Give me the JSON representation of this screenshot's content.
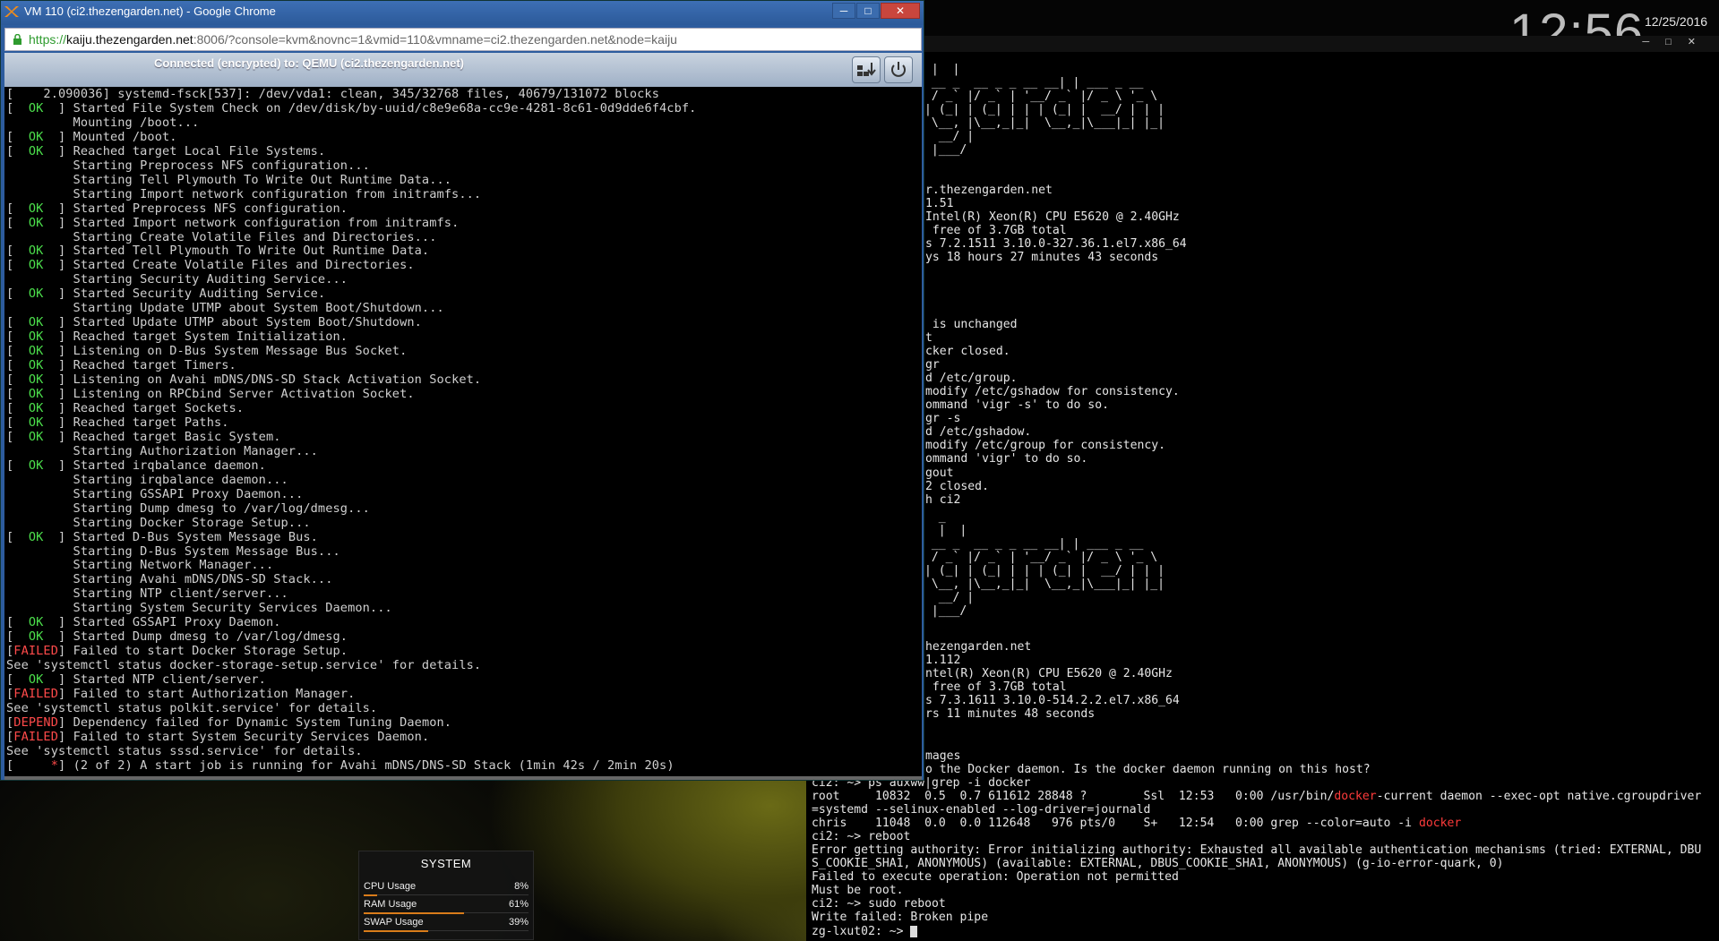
{
  "desktop": {
    "clock": "12:56",
    "date": "12/25/2016"
  },
  "browser": {
    "title": "VM 110 (ci2.thezengarden.net) - Google Chrome",
    "url_scheme": "https://",
    "url_host": "kaiju.thezengarden.net",
    "url_rest": ":8006/?console=kvm&novnc=1&vmid=110&vmname=ci2.thezengarden.net&node=kaiju",
    "minimize_label": "─",
    "maximize_label": "□",
    "close_label": "✕"
  },
  "novnc": {
    "status": "Connected (encrypted) to: QEMU (ci2.thezengarden.net)",
    "send_keys_icon": "keyboard-send-icon",
    "power_icon": "power-icon"
  },
  "console_lines": [
    {
      "text": "[    2.090036] systemd-fsck[537]: /dev/vda1: clean, 345/32768 files, 40679/131072 blocks"
    },
    {
      "status": "OK",
      "text": "Started File System Check on /dev/disk/by-uuid/c8e9e68a-cc9e-4281-8c61-0d9dde6f4cbf."
    },
    {
      "text": "         Mounting /boot..."
    },
    {
      "status": "OK",
      "text": "Mounted /boot."
    },
    {
      "status": "OK",
      "text": "Reached target Local File Systems."
    },
    {
      "text": "         Starting Preprocess NFS configuration..."
    },
    {
      "text": "         Starting Tell Plymouth To Write Out Runtime Data..."
    },
    {
      "text": "         Starting Import network configuration from initramfs..."
    },
    {
      "status": "OK",
      "text": "Started Preprocess NFS configuration."
    },
    {
      "status": "OK",
      "text": "Started Import network configuration from initramfs."
    },
    {
      "text": "         Starting Create Volatile Files and Directories..."
    },
    {
      "status": "OK",
      "text": "Started Tell Plymouth To Write Out Runtime Data."
    },
    {
      "status": "OK",
      "text": "Started Create Volatile Files and Directories."
    },
    {
      "text": "         Starting Security Auditing Service..."
    },
    {
      "status": "OK",
      "text": "Started Security Auditing Service."
    },
    {
      "text": "         Starting Update UTMP about System Boot/Shutdown..."
    },
    {
      "status": "OK",
      "text": "Started Update UTMP about System Boot/Shutdown."
    },
    {
      "status": "OK",
      "text": "Reached target System Initialization."
    },
    {
      "status": "OK",
      "text": "Listening on D-Bus System Message Bus Socket."
    },
    {
      "status": "OK",
      "text": "Reached target Timers."
    },
    {
      "status": "OK",
      "text": "Listening on Avahi mDNS/DNS-SD Stack Activation Socket."
    },
    {
      "status": "OK",
      "text": "Listening on RPCbind Server Activation Socket."
    },
    {
      "status": "OK",
      "text": "Reached target Sockets."
    },
    {
      "status": "OK",
      "text": "Reached target Paths."
    },
    {
      "status": "OK",
      "text": "Reached target Basic System."
    },
    {
      "text": "         Starting Authorization Manager..."
    },
    {
      "status": "OK",
      "text": "Started irqbalance daemon."
    },
    {
      "text": "         Starting irqbalance daemon..."
    },
    {
      "text": "         Starting GSSAPI Proxy Daemon..."
    },
    {
      "text": "         Starting Dump dmesg to /var/log/dmesg..."
    },
    {
      "text": "         Starting Docker Storage Setup..."
    },
    {
      "status": "OK",
      "text": "Started D-Bus System Message Bus."
    },
    {
      "text": "         Starting D-Bus System Message Bus..."
    },
    {
      "text": "         Starting Network Manager..."
    },
    {
      "text": "         Starting Avahi mDNS/DNS-SD Stack..."
    },
    {
      "text": "         Starting NTP client/server..."
    },
    {
      "text": "         Starting System Security Services Daemon..."
    },
    {
      "status": "OK",
      "text": "Started GSSAPI Proxy Daemon."
    },
    {
      "status": "OK",
      "text": "Started Dump dmesg to /var/log/dmesg."
    },
    {
      "status": "FAILED",
      "text": "Failed to start Docker Storage Setup."
    },
    {
      "text": "See 'systemctl status docker-storage-setup.service' for details."
    },
    {
      "status": "OK",
      "text": "Started NTP client/server."
    },
    {
      "status": "FAILED",
      "text": "Failed to start Authorization Manager."
    },
    {
      "text": "See 'systemctl status polkit.service' for details."
    },
    {
      "status": "DEPEND",
      "text": "Dependency failed for Dynamic System Tuning Daemon."
    },
    {
      "status": "FAILED",
      "text": "Failed to start System Security Services Daemon."
    },
    {
      "text": "See 'systemctl status sssd.service' for details."
    },
    {
      "status": "SPIN",
      "text": "(2 of 2) A start job is running for Avahi mDNS/DNS-SD Stack (1min 42s / 2min 20s)"
    }
  ],
  "terminal": {
    "minimize_label": "─",
    "maximize_label": "□",
    "close_label": "✕",
    "banner1": " |  |\n __ _  __ _ _ __ __| | ___ _ __\n / _` |/ _` | '__/ _` |/ _ \\ '_ \\\n| (_| | (_| | | | (_| |  __/ | | |\n \\__, |\\__,_|_|  \\__,_|\\___|_| |_|\n  __/ |\n |___/",
    "info1": "r.thezengarden.net\n1.51\nIntel(R) Xeon(R) CPU E5620 @ 2.40GHz\n free of 3.7GB total\ns 7.2.1511 3.10.0-327.36.1.el7.x86_64\nys 18 hours 27 minutes 43 seconds",
    "log": " is unchanged\nt\ncker closed.\ngr\nd /etc/group.\nmodify /etc/gshadow for consistency.\nommand 'vigr -s' to do so.\ngr -s\nd /etc/gshadow.\nmodify /etc/group for consistency.\nommand 'vigr' to do so.\ngout\n2 closed.\nh ci2",
    "banner2": "  _\n  |  |\n __ _  __ _ _ __ __| | ___ _ __\n / _` |/ _` | '__/ _` |/ _ \\ '_ \\\n| (_| | (_| | | | (_| |  __/ | | |\n \\__, |\\__,_|_|  \\__,_|\\___|_| |_|\n  __/ |\n |___/",
    "info2": "hezengarden.net\n1.112\nntel(R) Xeon(R) CPU E5620 @ 2.40GHz\n free of 3.7GB total\ns 7.3.1611 3.10.0-514.2.2.el7.x86_64\nrs 11 minutes 48 seconds",
    "images_line": "mages",
    "docker_error": "o the Docker daemon. Is the docker daemon running on this host?",
    "ps_prompt": "ci2: ~> ps auxww|grep -i docker",
    "ps_line1_a": "root     10832  0.5  0.7 611612 28848 ?        Ssl  12:53   0:00 /usr/bin/",
    "ps_line1_hl": "docker",
    "ps_line1_b": "-current daemon --exec-opt native.cgroupdriver",
    "ps_line2": "=systemd --selinux-enabled --log-driver=journald",
    "ps_line3_a": "chris    11048  0.0  0.0 112648   976 pts/0    S+   12:54   0:00 grep --color=auto -i ",
    "ps_line3_hl": "docker",
    "reboot_prompt": "ci2: ~> reboot",
    "err1": "Error getting authority: Error initializing authority: Exhausted all available authentication mechanisms (tried: EXTERNAL, DBU",
    "err2": "S_COOKIE_SHA1, ANONYMOUS) (available: EXTERNAL, DBUS_COOKIE_SHA1, ANONYMOUS) (g-io-error-quark, 0)",
    "err3": "Failed to execute operation: Operation not permitted",
    "err4": "Must be root.",
    "sudo_prompt": "ci2: ~> sudo reboot",
    "write_failed": "Write failed: Broken pipe",
    "final_prompt_host": "zg-lxut02",
    "final_prompt_rest": ": ~> "
  },
  "system_widget": {
    "title": "SYSTEM",
    "rows": [
      {
        "label": "CPU Usage",
        "value": "8%",
        "fraction": 0.08
      },
      {
        "label": "RAM Usage",
        "value": "61%",
        "fraction": 0.61
      },
      {
        "label": "SWAP Usage",
        "value": "39%",
        "fraction": 0.39
      }
    ]
  }
}
